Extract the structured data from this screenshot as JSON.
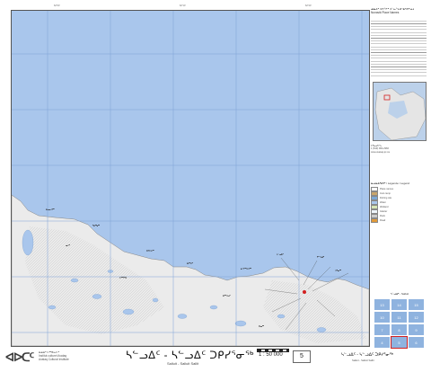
{
  "map": {
    "scale": "1 : 50 000",
    "sheet_number": "5",
    "colors": {
      "water": "#a9c6ec",
      "land": "#ececec",
      "snow": "#f6f6f6",
      "grid": "#7fa2d6",
      "ice": "#cfe0f3"
    }
  },
  "footer": {
    "logo_text": "ᐊᐅᑕᑦ",
    "logo_sub_1": "ᐃᓄᐃᑦ ᐅᕐᕿᓚᐅᑦ",
    "logo_sub_2": "Institut culturel Avataq",
    "logo_sub_3": "Avataq Cultural Institute",
    "title": "ᓴᓪᓗᐃᑦ - ᓴᓪᓗᐃᑦ ᑐᑭᓯᕐᓂᖅ",
    "subtitle": "Salluit - Salluit Sallit",
    "sheet_number": "5",
    "right_title": "ᓴᓪᓗᐃᑦ - ᓴᓪᓗᐃᑦ ᑐᑭᓯᕐᓂᖅ",
    "right_subtitle": "Salluit - Salluit Sallit"
  },
  "side": {
    "title_line": "ᓄᓇᕕᒃ ᐊᑎᖏᑦ ᐊᓪᓚᖓᓂ ᑲᑎᑎᕐᓗᒍ",
    "title_fr": "Nunavik Place Names",
    "contact_label": "ᐅᖃᓘᑎᖓ",
    "contact_phone": "1 (819) 964-2966",
    "contact_web": "www.avataq.qc.ca",
    "legend_title": "ᓇᓗᓇᐃᒃᑯᑎᑦ / Légende / Legend",
    "index_caption": "ᓴᓪᓗᐃᑦ - Salluit"
  },
  "legend_items": [
    {
      "label": "Place names",
      "color": "#ffffff"
    },
    {
      "label": "Inuit camp",
      "color": "#c9a56b"
    },
    {
      "label": "Fishing site",
      "color": "#7aa7d6"
    },
    {
      "label": "Water",
      "color": "#a9c6ec"
    },
    {
      "label": "Wetland",
      "color": "#d7e6b5"
    },
    {
      "label": "Glacier",
      "color": "#eef5fb"
    },
    {
      "label": "Rock",
      "color": "#cccccc"
    },
    {
      "label": "Road",
      "color": "#e19a3a"
    }
  ],
  "index_cells": [
    "13",
    "14",
    "15",
    "10",
    "11",
    "12",
    "7",
    "8",
    "9",
    "4",
    "5",
    "6"
  ]
}
